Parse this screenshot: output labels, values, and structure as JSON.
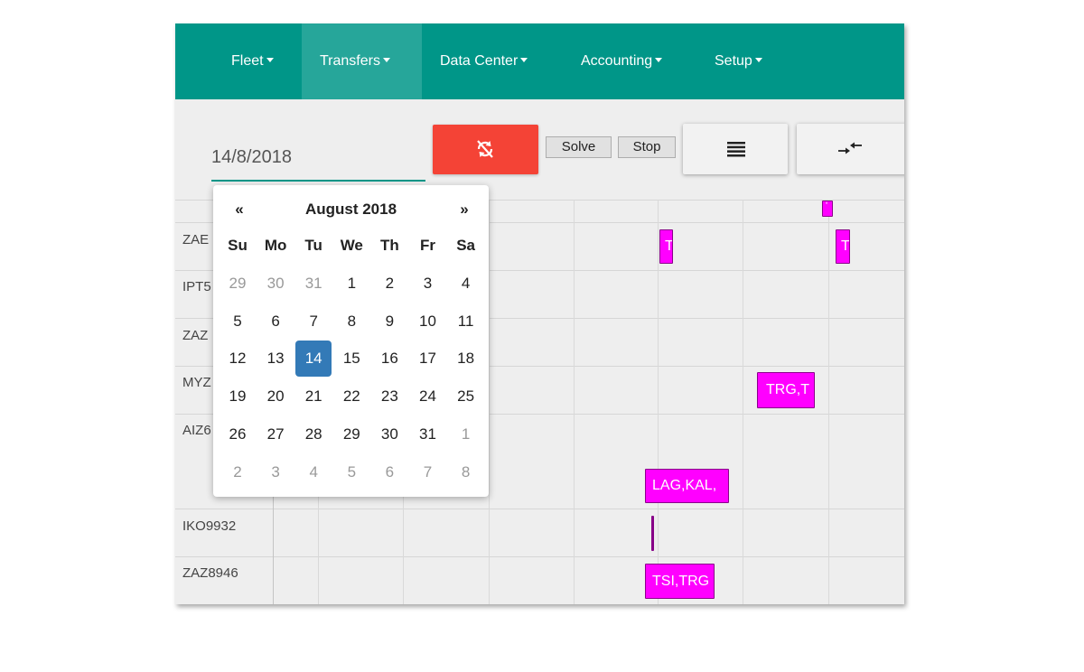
{
  "nav": {
    "items": [
      {
        "label": "Fleet"
      },
      {
        "label": "Transfers"
      },
      {
        "label": "Data Center"
      },
      {
        "label": "Accounting"
      },
      {
        "label": "Setup"
      }
    ],
    "active": "Transfers"
  },
  "toolbar": {
    "date_value": "14/8/2018",
    "refresh_icon": "sync-disabled-icon",
    "refresh_color": "#f44336",
    "solve_label": "Solve",
    "stop_label": "Stop",
    "list_icon": "list-icon",
    "collapse_icon": "compress-arrows-icon"
  },
  "rows": [
    {
      "label": "ZAE"
    },
    {
      "label": "IPT5"
    },
    {
      "label": "ZAZ"
    },
    {
      "label": "MYZ"
    },
    {
      "label": "AIZ6"
    },
    {
      "label": "IKO9932"
    },
    {
      "label": "ZAZ8946"
    }
  ],
  "blocks": [
    {
      "text": "'"
    },
    {
      "text": "T"
    },
    {
      "text": "T"
    },
    {
      "text": "TRG,T"
    },
    {
      "text": "LAG,KAL,"
    },
    {
      "text": ""
    },
    {
      "text": "TSI,TRG"
    }
  ],
  "datepicker": {
    "prev": "«",
    "next": "»",
    "title": "August 2018",
    "weekdays": [
      "Su",
      "Mo",
      "Tu",
      "We",
      "Th",
      "Fr",
      "Sa"
    ],
    "selected_day": 14,
    "weeks": [
      [
        {
          "d": "29",
          "m": true
        },
        {
          "d": "30",
          "m": true
        },
        {
          "d": "31",
          "m": true
        },
        {
          "d": "1"
        },
        {
          "d": "2"
        },
        {
          "d": "3"
        },
        {
          "d": "4"
        }
      ],
      [
        {
          "d": "5"
        },
        {
          "d": "6"
        },
        {
          "d": "7"
        },
        {
          "d": "8"
        },
        {
          "d": "9"
        },
        {
          "d": "10"
        },
        {
          "d": "11"
        }
      ],
      [
        {
          "d": "12"
        },
        {
          "d": "13"
        },
        {
          "d": "14",
          "a": true
        },
        {
          "d": "15"
        },
        {
          "d": "16"
        },
        {
          "d": "17"
        },
        {
          "d": "18"
        }
      ],
      [
        {
          "d": "19"
        },
        {
          "d": "20"
        },
        {
          "d": "21"
        },
        {
          "d": "22"
        },
        {
          "d": "23"
        },
        {
          "d": "24"
        },
        {
          "d": "25"
        }
      ],
      [
        {
          "d": "26"
        },
        {
          "d": "27"
        },
        {
          "d": "28"
        },
        {
          "d": "29"
        },
        {
          "d": "30"
        },
        {
          "d": "31"
        },
        {
          "d": "1",
          "m": true
        }
      ],
      [
        {
          "d": "2",
          "m": true
        },
        {
          "d": "3",
          "m": true
        },
        {
          "d": "4",
          "m": true
        },
        {
          "d": "5",
          "m": true
        },
        {
          "d": "6",
          "m": true
        },
        {
          "d": "7",
          "m": true
        },
        {
          "d": "8",
          "m": true
        }
      ]
    ]
  },
  "colors": {
    "nav": "#009688",
    "nav_active": "#26a69a",
    "block": "#ff00ff",
    "selected_day": "#337ab7"
  }
}
